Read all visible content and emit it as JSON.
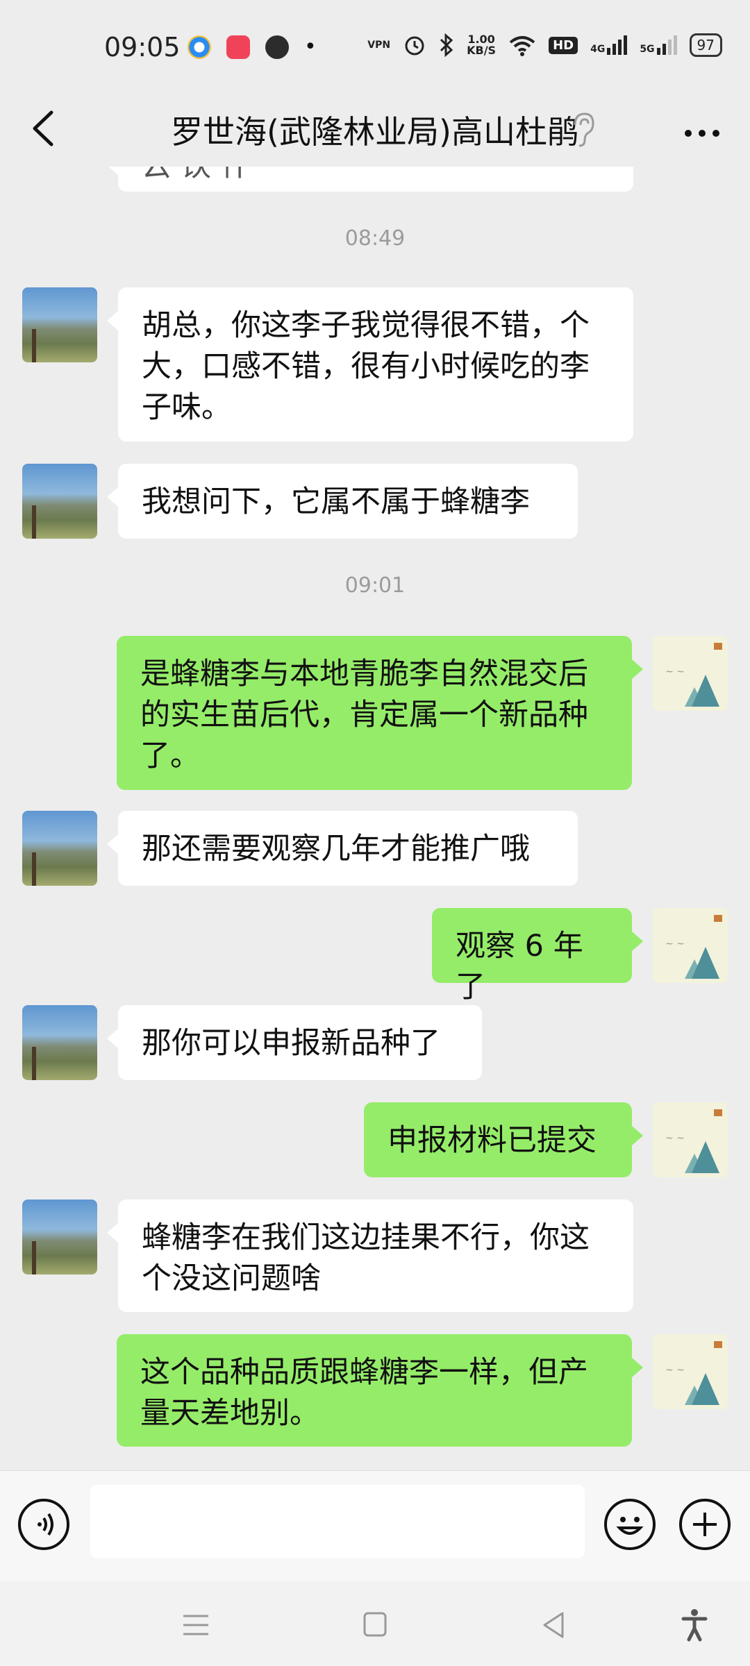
{
  "status_bar": {
    "time": "09:05",
    "net_speed_value": "1.00",
    "net_speed_unit": "KB/S",
    "vpn": "VPN",
    "hd": "HD",
    "sig1": "4G",
    "sig2": "5G",
    "battery": "97",
    "dot": "•"
  },
  "header": {
    "title": "罗世海(武隆林业局)高山杜鹃"
  },
  "chat": {
    "partial_top": "云 饮 什",
    "time_1": "08:49",
    "msg_1": "胡总，你这李子我觉得很不错，个大，口感不错，很有小时候吃的李子味。",
    "msg_2": "我想问下，它属不属于蜂糖李",
    "time_2": "09:01",
    "msg_3": "是蜂糖李与本地青脆李自然混交后的实生苗后代，肯定属一个新品种了。",
    "msg_4": "那还需要观察几年才能推广哦",
    "msg_5": "观察 6 年了",
    "msg_6": "那你可以申报新品种了",
    "msg_7": "申报材料已提交",
    "msg_8": "蜂糖李在我们这边挂果不行，你这个没这问题啥",
    "msg_9": "这个品种品质跟蜂糖李一样，但产量天差地别。"
  },
  "colors": {
    "background": "#ededed",
    "bubble_in": "#ffffff",
    "bubble_out": "#95ec69",
    "time_label": "#9b9b9b"
  },
  "icons": [
    "back-arrow-icon",
    "ear-icon",
    "more-icon",
    "voice-icon",
    "emoji-icon",
    "plus-icon",
    "nav-menu-icon",
    "nav-home-icon",
    "nav-back-icon",
    "accessibility-icon"
  ]
}
